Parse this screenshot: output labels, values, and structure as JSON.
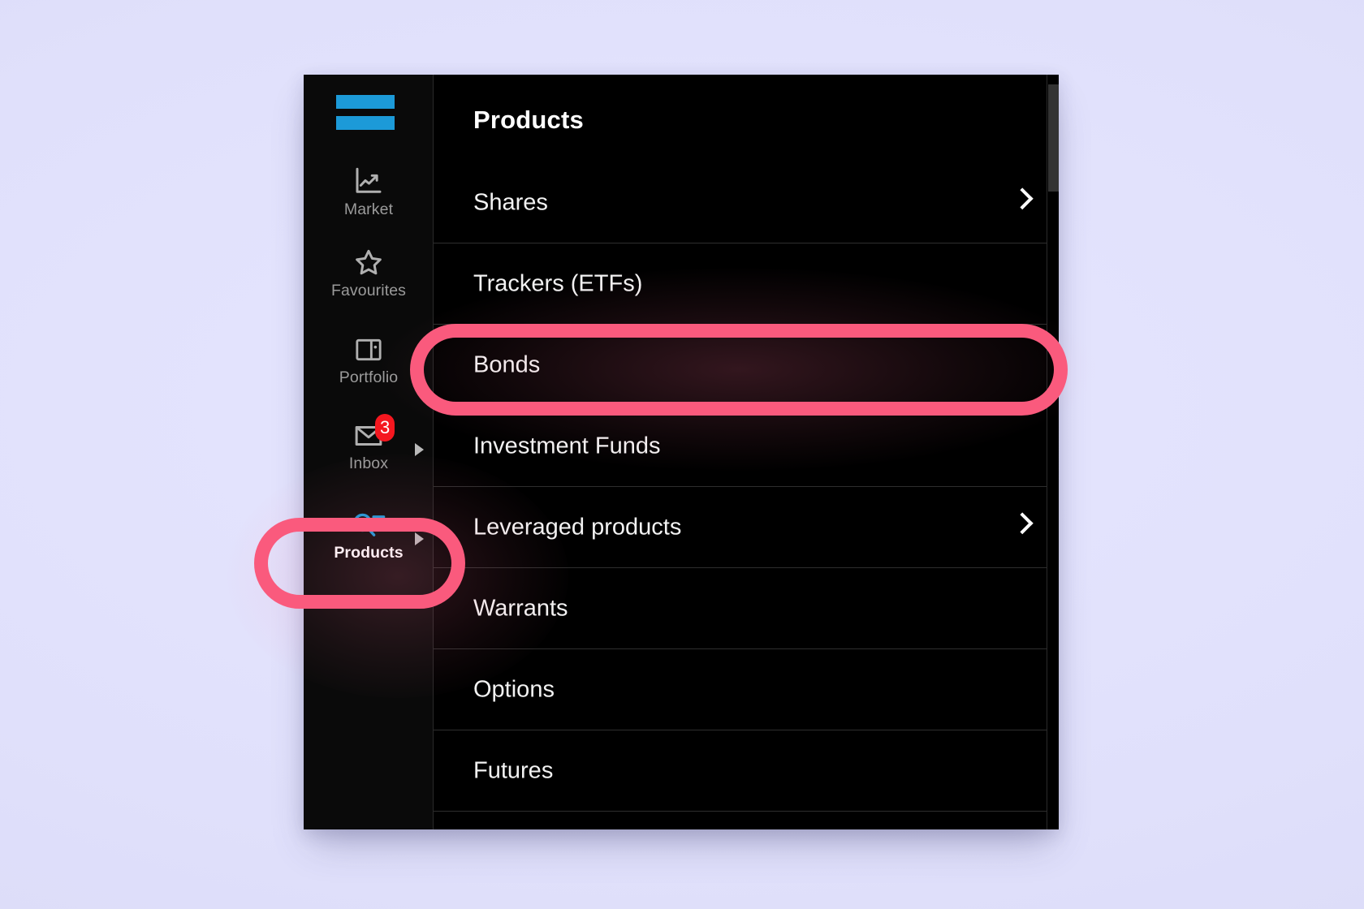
{
  "background": {
    "color": "#e2e2fd"
  },
  "app": {
    "brand": {
      "icon": "degiro-logo",
      "color": "#1c9ad8"
    },
    "panel_background": "#000000",
    "sidebar_background": "#0a0a0a"
  },
  "sidebar": {
    "items": [
      {
        "label": "Market",
        "icon": "chart-line-icon",
        "active": false,
        "has_submenu": false,
        "badge": null
      },
      {
        "label": "Favourites",
        "icon": "star-icon",
        "active": false,
        "has_submenu": false,
        "badge": null
      },
      {
        "label": "Portfolio",
        "icon": "wallet-icon",
        "active": false,
        "has_submenu": false,
        "badge": null
      },
      {
        "label": "Inbox",
        "icon": "envelope-icon",
        "active": false,
        "has_submenu": true,
        "badge": "3"
      },
      {
        "label": "Products",
        "icon": "search-list-icon",
        "active": true,
        "has_submenu": true,
        "badge": null
      }
    ],
    "badge_color": "#f5171f",
    "active_icon_color": "#1c9ad8"
  },
  "panel": {
    "title": "Products",
    "items": [
      {
        "label": "Shares",
        "has_chevron": true,
        "highlighted": false
      },
      {
        "label": "Trackers (ETFs)",
        "has_chevron": false,
        "highlighted": false
      },
      {
        "label": "Bonds",
        "has_chevron": false,
        "highlighted": true
      },
      {
        "label": "Investment Funds",
        "has_chevron": false,
        "highlighted": false
      },
      {
        "label": "Leveraged products",
        "has_chevron": true,
        "highlighted": false
      },
      {
        "label": "Warrants",
        "has_chevron": false,
        "highlighted": false
      },
      {
        "label": "Options",
        "has_chevron": false,
        "highlighted": false
      },
      {
        "label": "Futures",
        "has_chevron": false,
        "highlighted": false
      }
    ]
  },
  "annotations": {
    "color": "#fa5a7d",
    "shapes": [
      {
        "target": "Bonds",
        "type": "rounded-oval-outline"
      },
      {
        "target": "Products",
        "type": "rounded-oval-outline"
      }
    ]
  }
}
